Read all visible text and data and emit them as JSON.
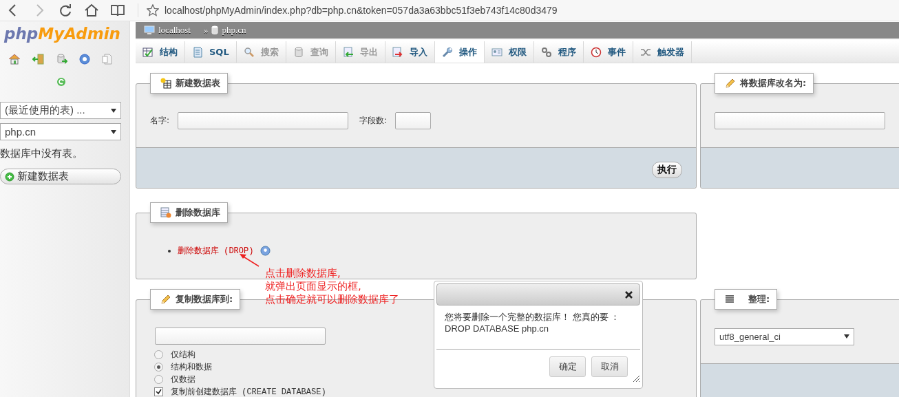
{
  "browser": {
    "url": "localhost/phpMyAdmin/index.php?db=php.cn&token=057da3a63bbc51f3eb743f14c80d3479"
  },
  "sidebar": {
    "logo": {
      "part_1": "php",
      "part_2": "MyAdmin"
    },
    "recent_tables": "(最近使用的表) ...",
    "database": "php.cn",
    "message": "数据库中没有表。",
    "new_table_button": "新建数据表"
  },
  "breadcrumb": {
    "server": "localhost",
    "separator": "»",
    "database": "php.cn"
  },
  "tabs": [
    {
      "label": "结构",
      "selected": false,
      "disabled": false
    },
    {
      "label": "SQL",
      "selected": false,
      "disabled": false
    },
    {
      "label": "搜索",
      "selected": false,
      "disabled": true
    },
    {
      "label": "查询",
      "selected": false,
      "disabled": true
    },
    {
      "label": "导出",
      "selected": false,
      "disabled": true
    },
    {
      "label": "导入",
      "selected": false,
      "disabled": false
    },
    {
      "label": "操作",
      "selected": true,
      "disabled": false
    },
    {
      "label": "权限",
      "selected": false,
      "disabled": false
    },
    {
      "label": "程序",
      "selected": false,
      "disabled": false
    },
    {
      "label": "事件",
      "selected": false,
      "disabled": false
    },
    {
      "label": "触发器",
      "selected": false,
      "disabled": false
    }
  ],
  "new_table": {
    "title": "新建数据表",
    "name_label": "名字:",
    "fields_label": "字段数:",
    "go_button": "执行"
  },
  "rename": {
    "title": "将数据库改名为:"
  },
  "drop": {
    "title": "删除数据库",
    "link": "删除数据库 (DROP)"
  },
  "copy": {
    "title": "复制数据库到:",
    "options": [
      {
        "label": "仅结构",
        "selected": false
      },
      {
        "label": "结构和数据",
        "selected": true
      },
      {
        "label": "仅数据",
        "selected": false
      }
    ],
    "create_database": {
      "label": "复制前创建数据库 (CREATE DATABASE)",
      "checked": true
    }
  },
  "collation": {
    "title": "整理:",
    "value": "utf8_general_ci"
  },
  "annotation": {
    "lines": [
      "点击删除数据库,",
      "就弹出页面显示的框,",
      "点击确定就可以删除数据库了"
    ]
  },
  "dialog": {
    "message_line_1": "您将要删除一个完整的数据库！ 您真的要 ：",
    "message_line_2": "DROP DATABASE php.cn",
    "ok_button": "确定",
    "cancel_button": "取消"
  }
}
